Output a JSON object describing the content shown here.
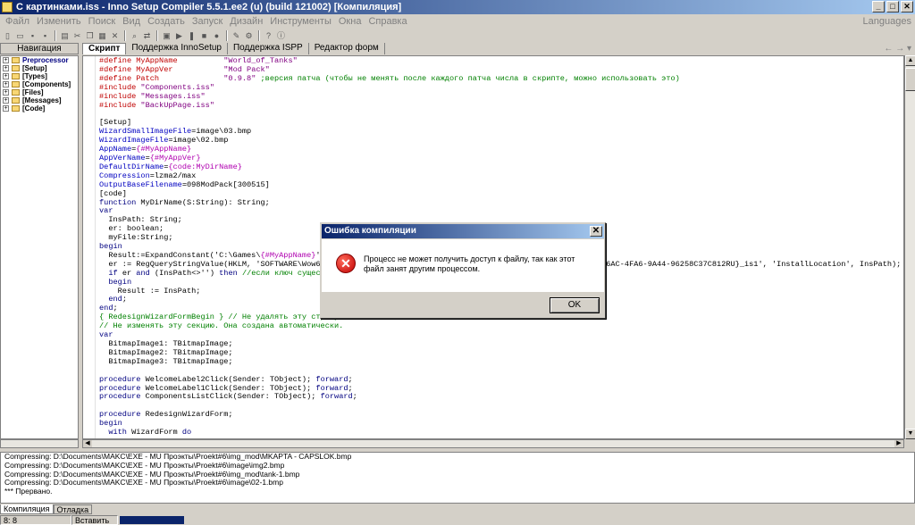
{
  "window": {
    "title": "С картинками.iss - Inno Setup Compiler 5.5.1.ee2 (u) (build 121002)  [Компиляция]",
    "buttons": [
      "_",
      "□",
      "✕"
    ]
  },
  "menu": {
    "items": [
      "Файл",
      "Изменить",
      "Поиск",
      "Вид",
      "Создать",
      "Запуск",
      "Дизайн",
      "Инструменты",
      "Окна",
      "Справка"
    ],
    "languages": "Languages"
  },
  "toolbar_icons": [
    "new-icon",
    "open-icon",
    "save-icon",
    "save-all-icon",
    "print-icon",
    "cut-icon",
    "copy-icon",
    "paste-icon",
    "delete-icon",
    "find-icon",
    "replace-icon",
    "compile-icon",
    "run-icon",
    "pause-icon",
    "stop-icon",
    "step-icon",
    "wizard-icon",
    "help-icon",
    "about-icon"
  ],
  "tabs": {
    "navigation": "Навигация",
    "items": [
      "Скрипт",
      "Поддержка InnoSetup",
      "Поддержка ISPP",
      "Редактор форм"
    ],
    "arrows": "← → ▾"
  },
  "tree": [
    {
      "label": "Preprocessor"
    },
    {
      "label": "[Setup]"
    },
    {
      "label": "[Types]"
    },
    {
      "label": "[Components]"
    },
    {
      "label": "[Files]"
    },
    {
      "label": "[Messages]"
    },
    {
      "label": "[Code]"
    }
  ],
  "code": [
    [
      [
        "dir",
        "#define MyAppName          "
      ],
      [
        "str",
        "\"World_of_Tanks\""
      ]
    ],
    [
      [
        "dir",
        "#define MyAppVer           "
      ],
      [
        "str",
        "\"Mod Pack\""
      ]
    ],
    [
      [
        "dir",
        "#define Patch              "
      ],
      [
        "str",
        "\"0.9.8\""
      ],
      [
        "com",
        " ;версия патча (чтобы не менять после каждого патча числа в скрипте, можно использовать это)"
      ]
    ],
    [
      [
        "dir",
        "#include "
      ],
      [
        "str",
        "\"Components.iss\""
      ]
    ],
    [
      [
        "dir",
        "#include "
      ],
      [
        "str",
        "\"Messages.iss\""
      ]
    ],
    [
      [
        "dir",
        "#include "
      ],
      [
        "str",
        "\"BackUpPage.iss\""
      ]
    ],
    [
      [
        "val",
        ""
      ]
    ],
    [
      [
        "sec",
        "[Setup]"
      ]
    ],
    [
      [
        "key",
        "WizardSmallImageFile"
      ],
      [
        "val",
        "=image\\03.bmp"
      ]
    ],
    [
      [
        "key",
        "WizardImageFile"
      ],
      [
        "val",
        "=image\\02.bmp"
      ]
    ],
    [
      [
        "key",
        "AppName"
      ],
      [
        "val",
        "="
      ],
      [
        "pur",
        "{#MyAppName}"
      ]
    ],
    [
      [
        "key",
        "AppVerName"
      ],
      [
        "val",
        "="
      ],
      [
        "pur",
        "{#MyAppVer}"
      ]
    ],
    [
      [
        "key",
        "DefaultDirName"
      ],
      [
        "val",
        "="
      ],
      [
        "pur",
        "{code:MyDirName}"
      ]
    ],
    [
      [
        "key",
        "Compression"
      ],
      [
        "val",
        "=lzma2/max"
      ]
    ],
    [
      [
        "key",
        "OutputBaseFilename"
      ],
      [
        "val",
        "=098ModPack[300515]"
      ]
    ],
    [
      [
        "sec",
        "[code]"
      ]
    ],
    [
      [
        "kw",
        "function"
      ],
      [
        "val",
        " MyDirName(S:String): String;"
      ]
    ],
    [
      [
        "kw",
        "var"
      ]
    ],
    [
      [
        "val",
        "  InsPath: String;"
      ]
    ],
    [
      [
        "val",
        "  er: boolean;"
      ]
    ],
    [
      [
        "val",
        "  myFile:String;"
      ]
    ],
    [
      [
        "kw",
        "begin"
      ]
    ],
    [
      [
        "val",
        "  Result:=ExpandConstant('C:\\Games\\"
      ],
      [
        "pur",
        "{#MyAppName}"
      ],
      [
        "val",
        "');"
      ]
    ],
    [
      [
        "val",
        "  er := RegQueryStringValue(HKLM, 'SOFTWARE\\Wow6432Node\\Microsoft\\Windows\\CurrentVersion\\Uninstall\\{1EAC1D02-C6AC-4FA6-9A44-96258C37C812RU}_is1', 'InstallLocation', InsPath);"
      ]
    ],
    [
      [
        "val",
        "  "
      ],
      [
        "kw",
        "if"
      ],
      [
        "val",
        " er "
      ],
      [
        "kw",
        "and"
      ],
      [
        "val",
        " (InsPath<>'') "
      ],
      [
        "kw",
        "then"
      ],
      [
        "com",
        " //если ключ существует"
      ]
    ],
    [
      [
        "val",
        "  "
      ],
      [
        "kw",
        "begin"
      ]
    ],
    [
      [
        "val",
        "    Result := InsPath;"
      ]
    ],
    [
      [
        "val",
        "  "
      ],
      [
        "kw",
        "end"
      ],
      [
        "val",
        ";"
      ]
    ],
    [
      [
        "kw",
        "end"
      ],
      [
        "val",
        ";"
      ]
    ],
    [
      [
        "com",
        "{ RedesignWizardFormBegin } // Не удалять эту строку!"
      ]
    ],
    [
      [
        "com",
        "// Не изменять эту секцию. Она создана автоматически."
      ]
    ],
    [
      [
        "kw",
        "var"
      ]
    ],
    [
      [
        "val",
        "  BitmapImage1: TBitmapImage;"
      ]
    ],
    [
      [
        "val",
        "  BitmapImage2: TBitmapImage;"
      ]
    ],
    [
      [
        "val",
        "  BitmapImage3: TBitmapImage;"
      ]
    ],
    [
      [
        "val",
        ""
      ]
    ],
    [
      [
        "kw",
        "procedure"
      ],
      [
        "val",
        " WelcomeLabel2Click(Sender: TObject); "
      ],
      [
        "kw",
        "forward"
      ],
      [
        "val",
        ";"
      ]
    ],
    [
      [
        "kw",
        "procedure"
      ],
      [
        "val",
        " WelcomeLabel1Click(Sender: TObject); "
      ],
      [
        "kw",
        "forward"
      ],
      [
        "val",
        ";"
      ]
    ],
    [
      [
        "kw",
        "procedure"
      ],
      [
        "val",
        " ComponentsListClick(Sender: TObject); "
      ],
      [
        "kw",
        "forward"
      ],
      [
        "val",
        ";"
      ]
    ],
    [
      [
        "val",
        ""
      ]
    ],
    [
      [
        "kw",
        "procedure"
      ],
      [
        "val",
        " RedesignWizardForm;"
      ]
    ],
    [
      [
        "kw",
        "begin"
      ]
    ],
    [
      [
        "val",
        "  "
      ],
      [
        "kw",
        "with"
      ],
      [
        "val",
        " WizardForm "
      ],
      [
        "kw",
        "do"
      ]
    ]
  ],
  "output": [
    "Compressing: D:\\Documents\\MAKC\\EXE - MU Проэкты\\Proekt#6\\img_mod\\MKAPTA - CAPSLOK.bmp",
    "Compressing: D:\\Documents\\MAKC\\EXE - MU Проэкты\\Proekt#6\\image\\img2.bmp",
    "Compressing: D:\\Documents\\MAKC\\EXE - MU Проэкты\\Proekt#6\\img_mod\\tank-1.bmp",
    "Compressing: D:\\Documents\\MAKC\\EXE - MU Проэкты\\Proekt#6\\image\\02-1.bmp",
    "*** Прервано."
  ],
  "output_tabs": [
    "Компиляция",
    "Отладка"
  ],
  "status": {
    "position": "8:   8",
    "mode": "Вставить",
    "progress": 1.0
  },
  "dialog": {
    "title": "Ошибка компиляции",
    "message": "Процесс не может получить доступ к файлу, так как этот файл занят другим процессом.",
    "ok": "OK",
    "icon": "error-icon"
  }
}
